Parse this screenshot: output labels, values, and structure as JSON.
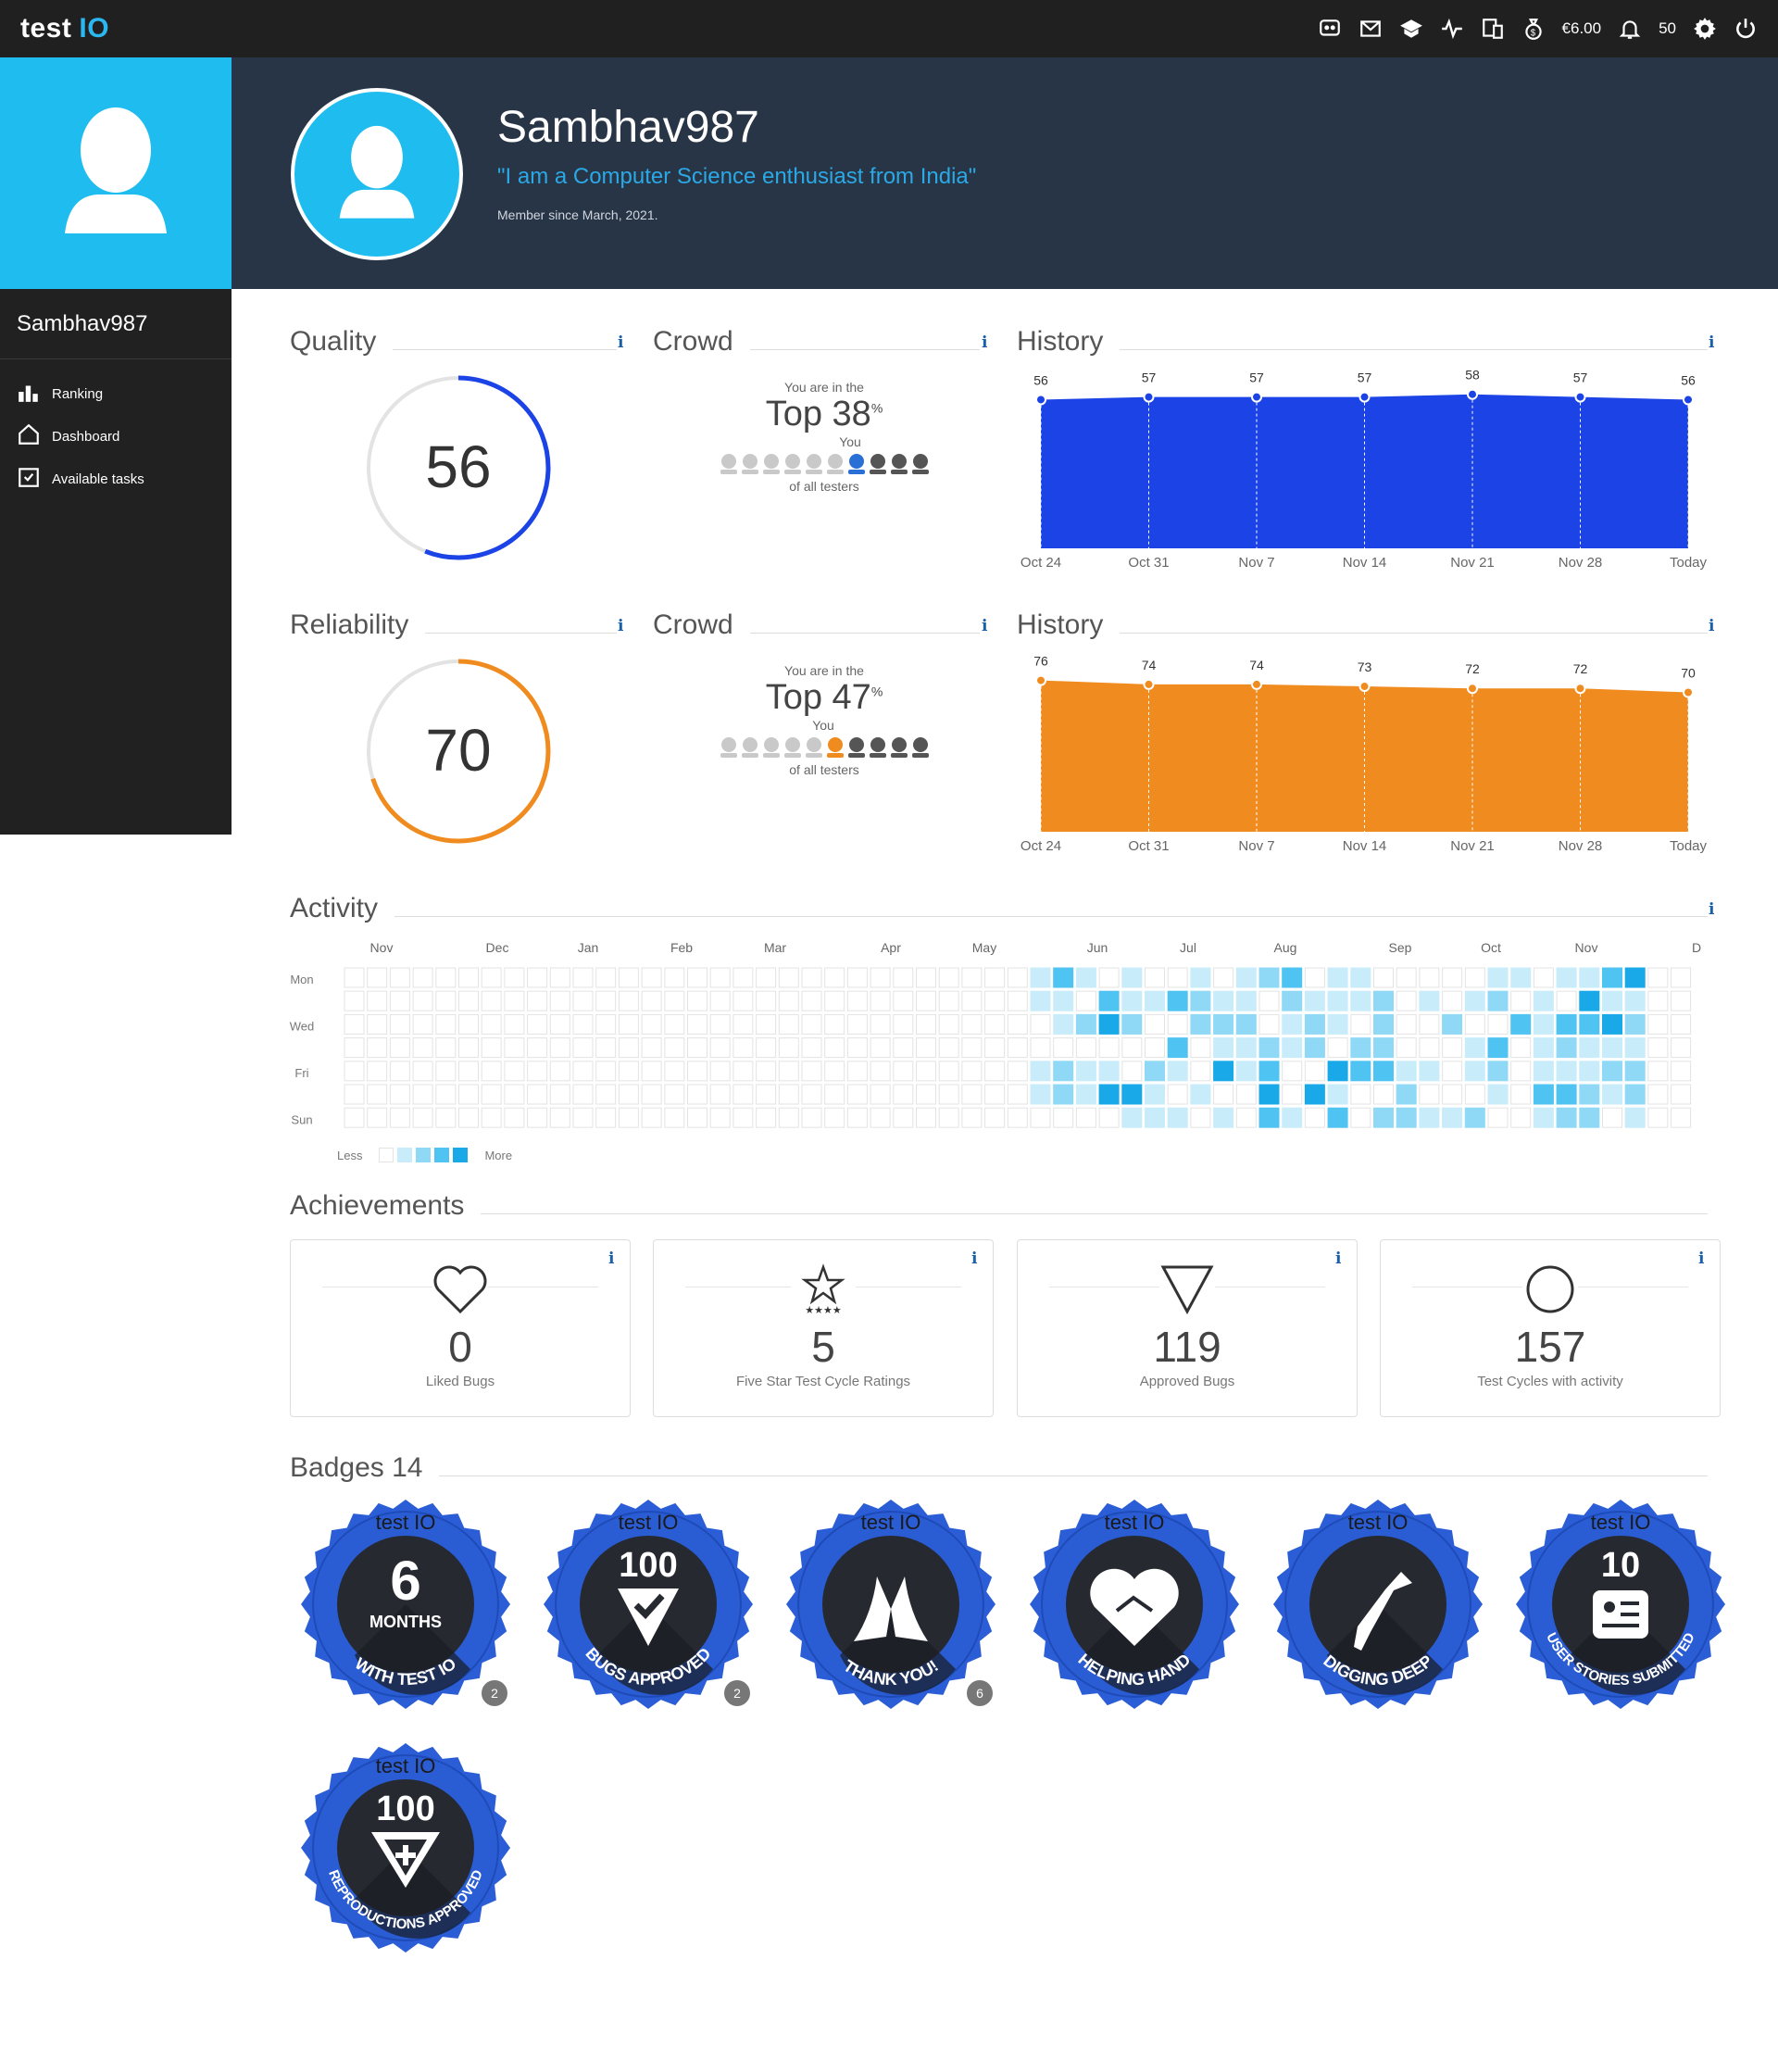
{
  "topbar": {
    "logo_a": "test",
    "logo_b": "IO",
    "balance": "€6.00",
    "notifications": "50",
    "icons": [
      "chat-icon",
      "mail-icon",
      "graduation-cap-icon",
      "activity-icon",
      "devices-icon",
      "money-bag-icon",
      "bell-icon",
      "gear-icon",
      "power-icon"
    ]
  },
  "sidebar": {
    "username": "Sambhav987",
    "items": [
      {
        "label": "Ranking",
        "icon": "ranking-icon"
      },
      {
        "label": "Dashboard",
        "icon": "home-icon"
      },
      {
        "label": "Available tasks",
        "icon": "tasks-icon"
      }
    ]
  },
  "profile": {
    "name": "Sambhav987",
    "quote": "\"I am a Computer Science enthusiast from India\"",
    "member_since": "Member since March, 2021."
  },
  "quality": {
    "title": "Quality",
    "value": "56",
    "score": 56,
    "color": "#1b43e6"
  },
  "reliability": {
    "title": "Reliability",
    "value": "70",
    "score": 70,
    "color": "#f08c1f"
  },
  "crowd1": {
    "title": "Crowd",
    "pre": "You are in the",
    "top": "Top 38",
    "pct": "%",
    "you": "You",
    "post": "of all testers",
    "you_index": 6,
    "color": "#2a6fd6"
  },
  "crowd2": {
    "title": "Crowd",
    "pre": "You are in the",
    "top": "Top 47",
    "pct": "%",
    "you": "You",
    "post": "of all testers",
    "you_index": 5,
    "color": "#f08c1f"
  },
  "history_title": "History",
  "info": "i",
  "chart_data": [
    {
      "type": "area",
      "x": [
        "Oct 24",
        "Oct 31",
        "Nov 7",
        "Nov 14",
        "Nov 21",
        "Nov 28",
        "Today"
      ],
      "values": [
        56,
        57,
        57,
        57,
        58,
        57,
        56
      ],
      "labels": [
        "56",
        "57",
        "57",
        "57",
        "58",
        "57",
        "56"
      ],
      "color": "#1b43e6",
      "ylim": [
        0,
        60
      ]
    },
    {
      "type": "area",
      "x": [
        "Oct 24",
        "Oct 31",
        "Nov 7",
        "Nov 14",
        "Nov 21",
        "Nov 28",
        "Today"
      ],
      "values": [
        76,
        74,
        74,
        73,
        72,
        72,
        70
      ],
      "labels": [
        "76",
        "74",
        "74",
        "73",
        "72",
        "72",
        "70"
      ],
      "color": "#f08c1f",
      "ylim": [
        0,
        80
      ]
    }
  ],
  "activity": {
    "title": "Activity",
    "months": [
      "Nov",
      "Dec",
      "Jan",
      "Feb",
      "Mar",
      "Apr",
      "May",
      "Jun",
      "Jul",
      "Aug",
      "Sep",
      "Oct",
      "Nov",
      "D"
    ],
    "days": [
      "Mon",
      "Wed",
      "Fri",
      "Sun"
    ],
    "less": "Less",
    "more": "More",
    "colors": [
      "#ffffff",
      "#c8ecfa",
      "#8fd8f6",
      "#4fc3f2",
      "#19a9e8"
    ]
  },
  "achievements": {
    "title": "Achievements",
    "items": [
      {
        "value": "0",
        "label": "Liked Bugs",
        "icon": "heart-icon"
      },
      {
        "value": "5",
        "label": "Five Star Test Cycle Ratings",
        "icon": "star-icon"
      },
      {
        "value": "119",
        "label": "Approved Bugs",
        "icon": "triangle-icon"
      },
      {
        "value": "157",
        "label": "Test Cycles with activity",
        "icon": "circle-icon"
      }
    ]
  },
  "badges": {
    "title": "Badges 14",
    "items": [
      {
        "brand": "test IO",
        "big": "6",
        "mid": "MONTHS",
        "ring": "WITH TEST IO",
        "count": "2",
        "icon": "six-months-badge-icon"
      },
      {
        "brand": "test IO",
        "big": "100",
        "ring": "BUGS APPROVED",
        "count": "2",
        "icon": "bugs-approved-badge-icon"
      },
      {
        "brand": "test IO",
        "ring": "THANK YOU!",
        "count": "6",
        "icon": "thank-you-badge-icon"
      },
      {
        "brand": "test IO",
        "ring": "HELPING HAND",
        "icon": "helping-hand-badge-icon"
      },
      {
        "brand": "test IO",
        "ring": "DIGGING DEEP",
        "icon": "digging-deep-badge-icon"
      },
      {
        "brand": "test IO",
        "big": "10",
        "ring": "USER STORIES SUBMITTED",
        "icon": "user-stories-badge-icon"
      },
      {
        "brand": "test IO",
        "big": "100",
        "ring": "REPRODUCTIONS APPROVED",
        "icon": "reproductions-badge-icon"
      }
    ]
  }
}
